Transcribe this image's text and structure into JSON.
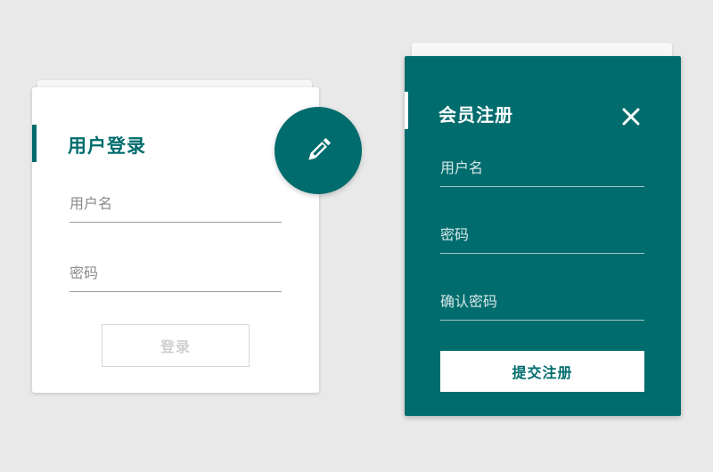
{
  "login": {
    "title": "用户登录",
    "username_placeholder": "用户名",
    "password_placeholder": "密码",
    "login_label": "登录"
  },
  "edit_fab": {
    "icon": "pencil-icon"
  },
  "register": {
    "title": "会员注册",
    "username_placeholder": "用户名",
    "password_placeholder": "密码",
    "confirm_password_placeholder": "确认密码",
    "submit_label": "提交注册",
    "close_icon": "close-icon"
  },
  "colors": {
    "brand": "#006c6d",
    "background": "#e9e9e9",
    "card": "#ffffff",
    "muted_text": "#8a8a8a"
  }
}
